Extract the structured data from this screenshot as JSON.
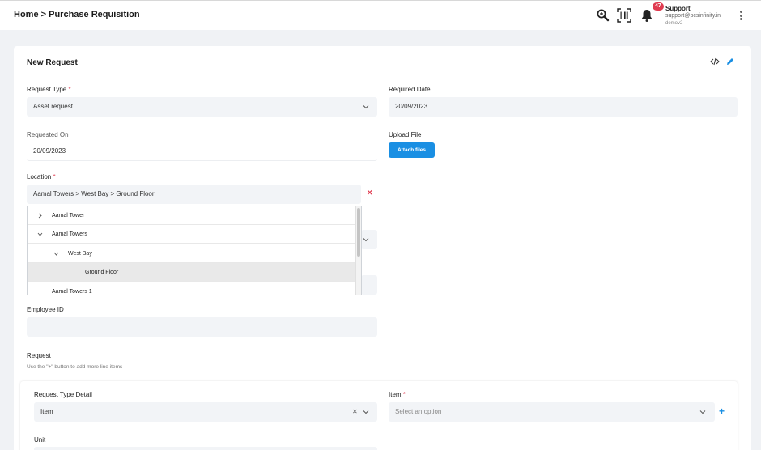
{
  "breadcrumb": {
    "home": "Home",
    "separator": ">",
    "current": "Purchase Requisition"
  },
  "header": {
    "notification_count": "47",
    "user_name": "Support",
    "user_email": "support@pcsinfinity.in",
    "tenant": "demov2"
  },
  "form": {
    "title": "New Request",
    "request_type": {
      "label": "Request Type",
      "value": "Asset request"
    },
    "required_date": {
      "label": "Required Date",
      "value": "20/09/2023"
    },
    "requested_on": {
      "label": "Requested On",
      "value": "20/09/2023"
    },
    "upload_file": {
      "label": "Upload File",
      "button": "Attach files"
    },
    "location": {
      "label": "Location",
      "value": "Aamal Towers > West Bay > Ground Floor",
      "tree": [
        {
          "label": "Aamal Tower",
          "level": 0,
          "arrow": "right"
        },
        {
          "label": "Aamal Towers",
          "level": 0,
          "arrow": "down"
        },
        {
          "label": "West Bay",
          "level": 1,
          "arrow": "down"
        },
        {
          "label": "Ground Floor",
          "level": 2,
          "arrow": "none",
          "selected": true
        },
        {
          "label": "Aamal Towers 1",
          "level": 0,
          "arrow": "none"
        }
      ]
    },
    "employee_id": {
      "label": "Employee ID",
      "value": ""
    },
    "request_section": {
      "title": "Request",
      "hint": "Use the \"+\" button to add more line items"
    },
    "line_item": {
      "request_type_detail": {
        "label": "Request Type Detail",
        "value": "Item"
      },
      "item": {
        "label": "Item",
        "placeholder": "Select an option"
      },
      "unit": {
        "label": "Unit"
      }
    }
  },
  "colors": {
    "accent": "#1a8fe3",
    "required": "#e03b50",
    "field_bg": "#f2f4f7",
    "badge": "#e03b50"
  }
}
